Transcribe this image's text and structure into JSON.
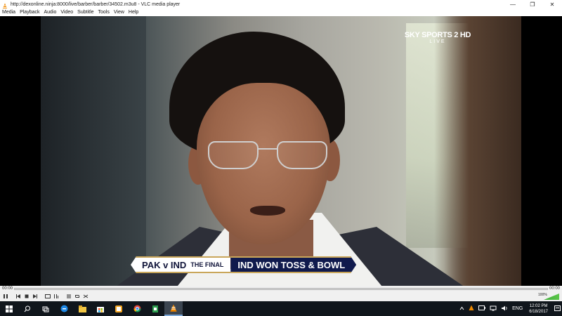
{
  "window": {
    "title": "http://dexonline.ninja:8000/live/barber/barber/34502.m3u8 - VLC media player",
    "minimize": "—",
    "maximize": "❐",
    "close": "✕"
  },
  "menu": {
    "items": [
      "Media",
      "Playback",
      "Audio",
      "Video",
      "Subtitle",
      "Tools",
      "View",
      "Help"
    ]
  },
  "video": {
    "channel_logo": "SKY SPORTS 2 HD",
    "channel_status": "LIVE",
    "ticker_match": "PAK v IND",
    "ticker_round": "THE FINAL",
    "ticker_message": "IND WON TOSS & BOWL"
  },
  "controls": {
    "elapsed": "00:00",
    "total": "00:00",
    "volume": "100%",
    "icons": [
      "pause-icon",
      "previous-icon",
      "stop-icon",
      "next-icon",
      "fullscreen-icon",
      "extended-settings-icon",
      "playlist-icon",
      "loop-icon",
      "shuffle-icon"
    ],
    "accent": "#3fae3a"
  },
  "taskbar": {
    "language": "ENG",
    "time": "12:02 PM",
    "date": "6/18/2017",
    "accent": "#7aa7d8"
  }
}
